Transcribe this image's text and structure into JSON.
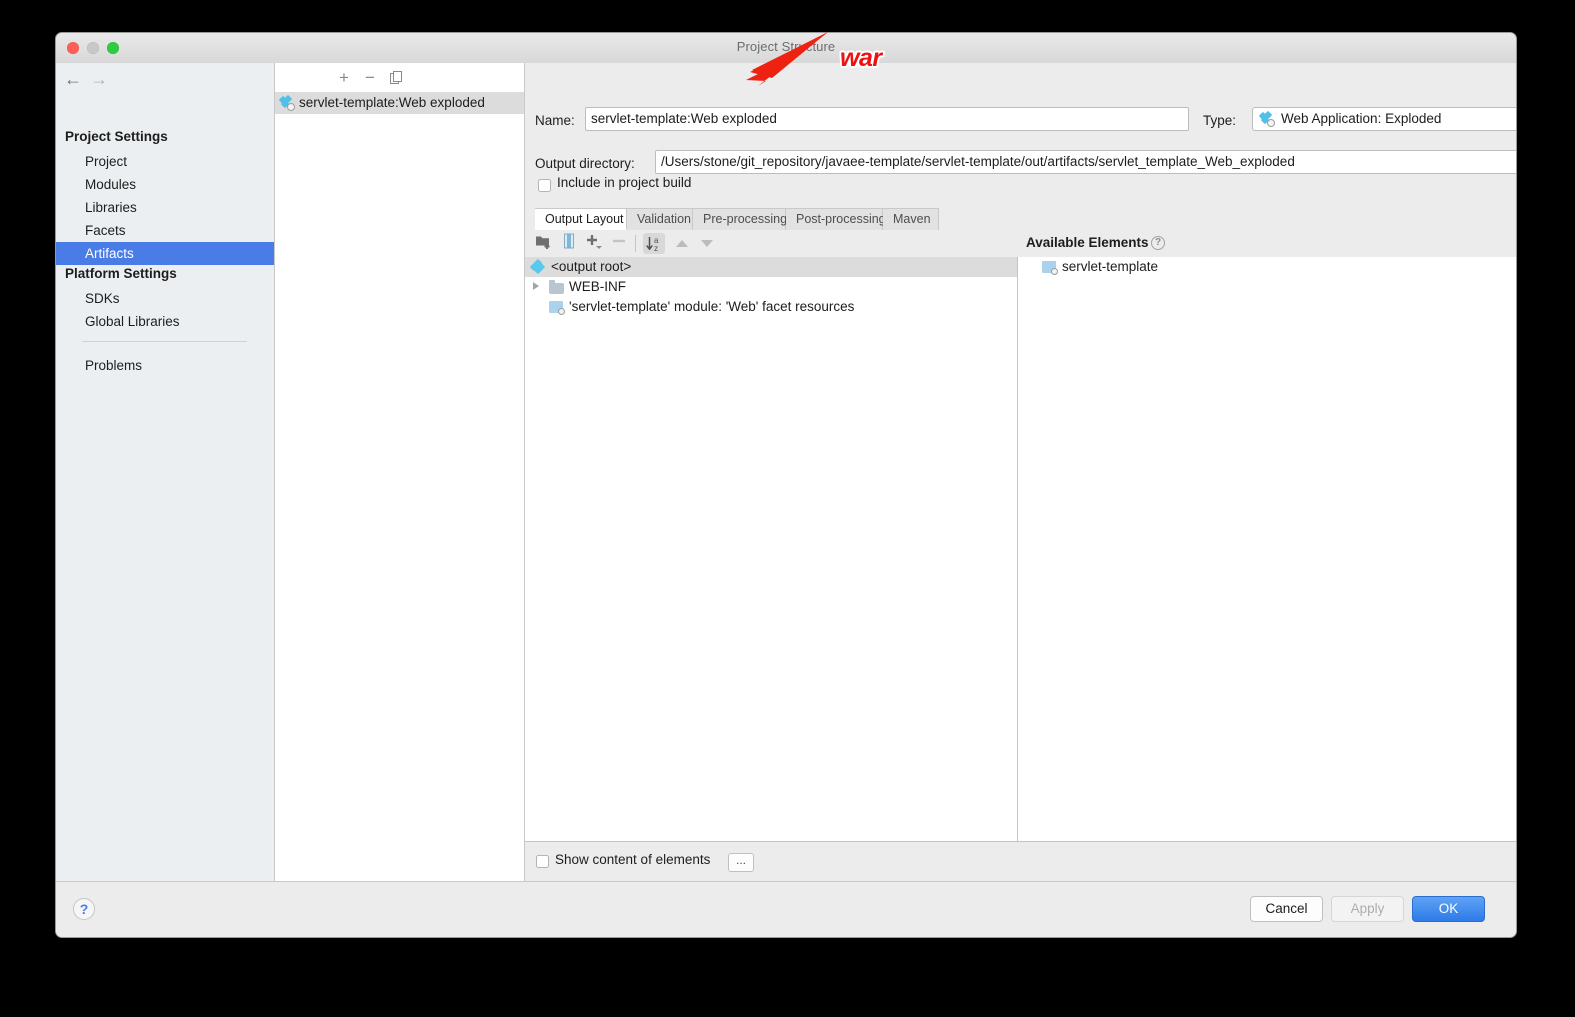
{
  "window": {
    "title": "Project Structure",
    "traffic_lights": [
      "close",
      "minimize",
      "zoom"
    ]
  },
  "sidebar": {
    "nav": {
      "back": "←",
      "forward": "→"
    },
    "groups": [
      {
        "label": "Project Settings",
        "items": [
          {
            "label": "Project",
            "selected": false
          },
          {
            "label": "Modules",
            "selected": false
          },
          {
            "label": "Libraries",
            "selected": false
          },
          {
            "label": "Facets",
            "selected": false
          },
          {
            "label": "Artifacts",
            "selected": true
          }
        ]
      },
      {
        "label": "Platform Settings",
        "items": [
          {
            "label": "SDKs",
            "selected": false
          },
          {
            "label": "Global Libraries",
            "selected": false
          }
        ]
      }
    ],
    "extra_items": [
      {
        "label": "Problems",
        "selected": false
      }
    ]
  },
  "artifact_list": {
    "toolbar": {
      "add": "+",
      "remove": "−",
      "copy": "copy-icon"
    },
    "items": [
      {
        "label": "servlet-template:Web exploded",
        "icon": "artifact-icon",
        "selected": true
      }
    ]
  },
  "detail": {
    "name_label": "Name:",
    "name_value": "servlet-template:Web exploded",
    "type_label": "Type:",
    "type_value": "Web Application: Exploded",
    "output_dir_label": "Output directory:",
    "output_dir_value": "/Users/stone/git_repository/javaee-template/servlet-template/out/artifacts/servlet_template_Web_exploded",
    "include_in_build_label": "Include in project build",
    "include_in_build_checked": false,
    "tabs": [
      {
        "label": "Output Layout",
        "active": true
      },
      {
        "label": "Validation",
        "active": false
      },
      {
        "label": "Pre-processing",
        "active": false
      },
      {
        "label": "Post-processing",
        "active": false
      },
      {
        "label": "Maven",
        "active": false
      }
    ],
    "layout_toolbar": [
      {
        "name": "create-directory-icon"
      },
      {
        "name": "create-archive-icon"
      },
      {
        "name": "add-copy-of-icon"
      },
      {
        "name": "remove-icon"
      },
      {
        "name": "sort-alphabetically-icon"
      },
      {
        "name": "move-up-icon"
      },
      {
        "name": "move-down-icon"
      }
    ],
    "tree": {
      "rows": [
        {
          "label": "<output root>",
          "icon": "output-root-icon",
          "indent": 0,
          "highlighted": true,
          "expandable": false
        },
        {
          "label": "WEB-INF",
          "icon": "folder-icon",
          "indent": 1,
          "highlighted": false,
          "expandable": true
        },
        {
          "label": "'servlet-template' module: 'Web' facet resources",
          "icon": "module-facet-icon",
          "indent": 1,
          "highlighted": false,
          "expandable": false
        }
      ]
    },
    "available_elements": {
      "header": "Available Elements",
      "help_icon": "?",
      "rows": [
        {
          "label": "servlet-template",
          "icon": "module-icon"
        }
      ]
    },
    "show_content_label": "Show content of elements",
    "show_content_checked": false,
    "dots_button": "..."
  },
  "footer": {
    "help": "?",
    "cancel": "Cancel",
    "apply": "Apply",
    "ok": "OK"
  },
  "annotation": {
    "text": "war",
    "color": "#ee1111",
    "arrow_color": "#ee2211"
  }
}
